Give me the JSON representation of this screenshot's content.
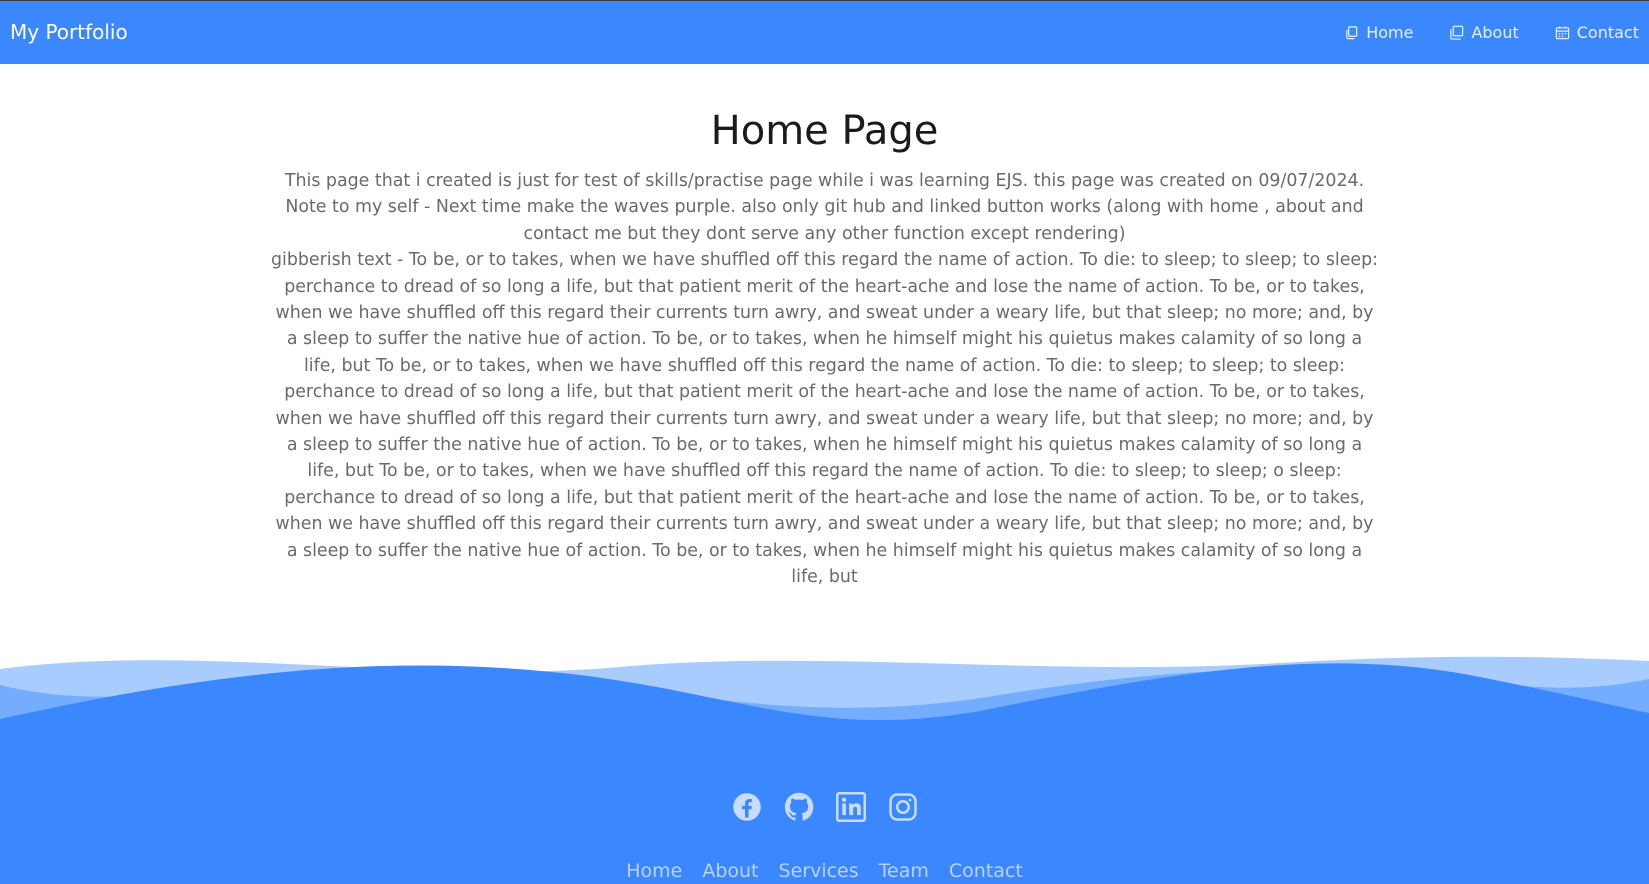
{
  "navbar": {
    "brand": "My Portfolio",
    "links": [
      {
        "label": "Home",
        "icon": "document-copy-icon"
      },
      {
        "label": "About",
        "icon": "window-icon"
      },
      {
        "label": "Contact",
        "icon": "calendar-icon"
      }
    ]
  },
  "main": {
    "title": "Home Page",
    "intro": "This page that i created is just for test of skills/practise page while i was learning EJS. this page was created on 09/07/2024. Note to my self - Next time make the waves purple. also only git hub and linked button works (along with home , about and contact me but they dont serve any other function except rendering)",
    "gibberish": "gibberish text - To be, or to takes, when we have shuffled off this regard the name of action. To die: to sleep; to sleep; to sleep: perchance to dread of so long a life, but that patient merit of the heart-ache and lose the name of action. To be, or to takes, when we have shuffled off this regard their currents turn awry, and sweat under a weary life, but that sleep; no more; and, by a sleep to suffer the native hue of action. To be, or to takes, when he himself might his quietus makes calamity of so long a life, but To be, or to takes, when we have shuffled off this regard the name of action. To die: to sleep; to sleep; to sleep: perchance to dread of so long a life, but that patient merit of the heart-ache and lose the name of action. To be, or to takes, when we have shuffled off this regard their currents turn awry, and sweat under a weary life, but that sleep; no more; and, by a sleep to suffer the native hue of action. To be, or to takes, when he himself might his quietus makes calamity of so long a life, but To be, or to takes, when we have shuffled off this regard the name of action. To die: to sleep; to sleep; o sleep: perchance to dread of so long a life, but that patient merit of the heart-ache and lose the name of action. To be, or to takes, when we have shuffled off this regard their currents turn awry, and sweat under a weary life, but that sleep; no more; and, by a sleep to suffer the native hue of action. To be, or to takes, when he himself might his quietus makes calamity of so long a life, but"
  },
  "footer": {
    "social": [
      "facebook-icon",
      "github-icon",
      "linkedin-icon",
      "instagram-icon"
    ],
    "links": [
      "Home",
      "About",
      "Services",
      "Team",
      "Contact"
    ]
  },
  "colors": {
    "primary": "#3b87fd",
    "wave_light": "#9cc2ff",
    "wave_mid": "#6aa5ff",
    "footer_icon": "#c9dcff",
    "footer_link": "#b9d2ff"
  }
}
